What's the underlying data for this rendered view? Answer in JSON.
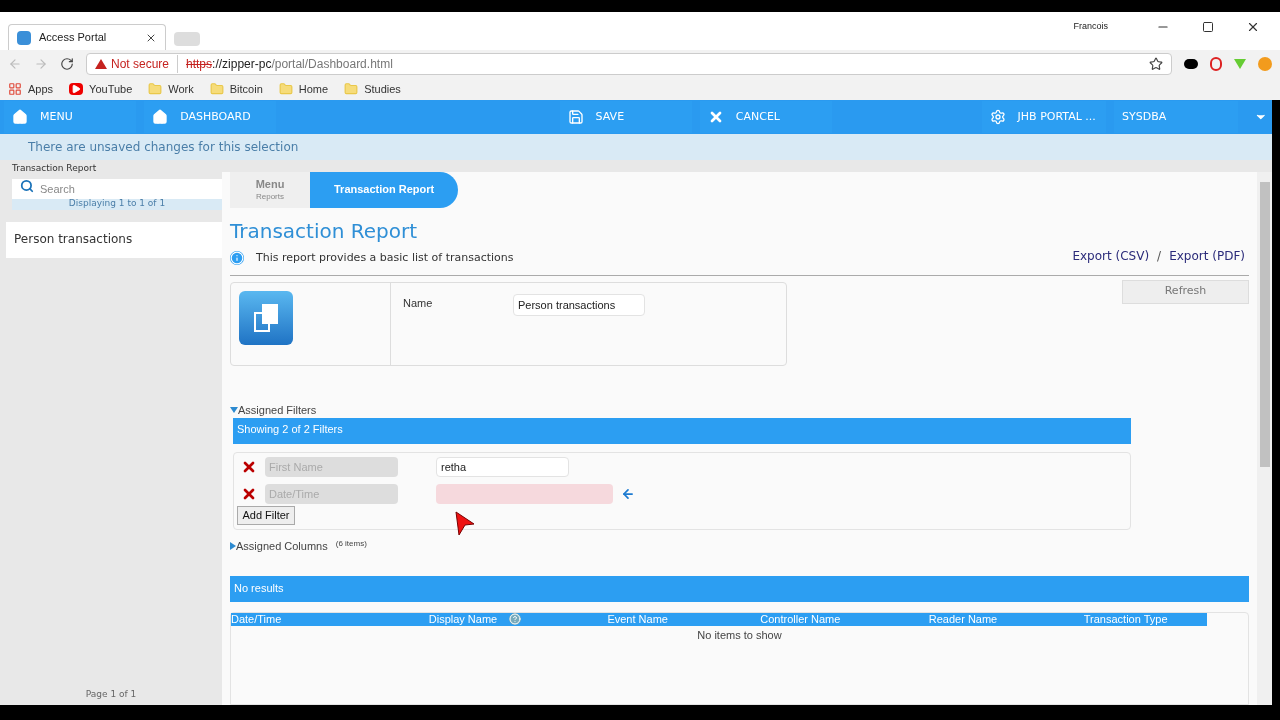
{
  "browser": {
    "tab_title": "Access Portal",
    "user": "Francois",
    "security": "Not secure",
    "url_scheme": "https",
    "url_host": "://zipper-pc",
    "url_path": "/portal/Dashboard.html",
    "bookmarks": [
      {
        "kind": "apps",
        "label": "Apps"
      },
      {
        "kind": "youtube",
        "label": "YouTube"
      },
      {
        "kind": "folder",
        "label": "Work"
      },
      {
        "kind": "folder",
        "label": "Bitcoin"
      },
      {
        "kind": "folder",
        "label": "Home"
      },
      {
        "kind": "folder",
        "label": "Studies"
      }
    ]
  },
  "nav": {
    "left": [
      {
        "kind": "home",
        "label": "MENU"
      },
      {
        "kind": "home",
        "label": "DASHBOARD"
      }
    ],
    "middle": [
      {
        "kind": "save",
        "label": "SAVE"
      },
      {
        "kind": "cancel",
        "label": "CANCEL"
      }
    ],
    "right": [
      {
        "kind": "settings",
        "label": "JHB PORTAL ..."
      },
      {
        "kind": "plain",
        "label": "SYSDBA"
      }
    ]
  },
  "banner": "There are unsaved changes for this selection",
  "sidebar": {
    "title": "Transaction Report",
    "search_placeholder": "Search",
    "count": "Displaying 1 to 1 of 1",
    "items": [
      {
        "label": "Person transactions",
        "selected": false
      }
    ],
    "footer": "Page 1 of 1"
  },
  "breadcrumb": [
    {
      "label": "Menu",
      "sub": "Reports",
      "selected": false
    },
    {
      "label": "Transaction Report",
      "selected": true
    }
  ],
  "report": {
    "title": "Transaction Report",
    "info": "This report provides a basic list of transactions",
    "exports": [
      "Export (CSV)",
      "Export (PDF)"
    ],
    "separator": "/",
    "refresh": "Refresh",
    "name_label": "Name",
    "name_value": "Person transactions"
  },
  "filters": {
    "heading": "Assigned Filters",
    "expanded": true,
    "summary": "Showing 2 of 2 Filters",
    "rows": [
      {
        "field_placeholder": "First Name",
        "value": "retha",
        "invalid": false
      },
      {
        "field_placeholder": "Date/Time",
        "value": "",
        "invalid": true
      }
    ],
    "add": "Add Filter"
  },
  "columns_section": {
    "heading": "Assigned Columns",
    "count": "(6 items)",
    "expanded": false
  },
  "results": {
    "summary": "No results",
    "columns": [
      "Date/Time",
      "Display Name",
      "Event Name",
      "Controller Name",
      "Reader Name",
      "Transaction Type"
    ],
    "empty": "No items to show"
  }
}
